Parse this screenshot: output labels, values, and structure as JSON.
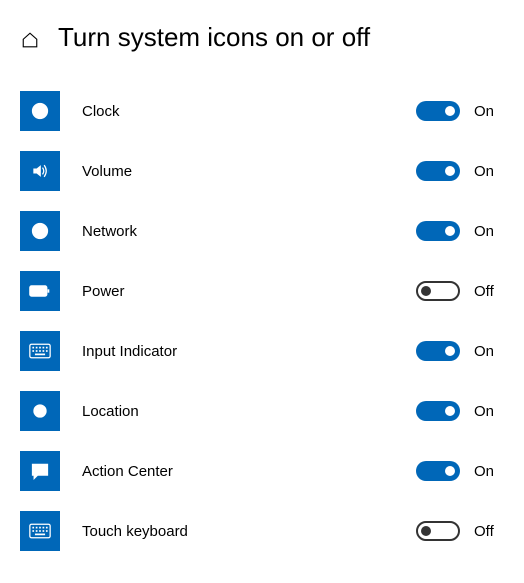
{
  "header": {
    "title": "Turn system icons on or off"
  },
  "state_labels": {
    "on": "On",
    "off": "Off"
  },
  "items": [
    {
      "id": "clock",
      "label": "Clock",
      "on": true
    },
    {
      "id": "volume",
      "label": "Volume",
      "on": true
    },
    {
      "id": "network",
      "label": "Network",
      "on": true
    },
    {
      "id": "power",
      "label": "Power",
      "on": false
    },
    {
      "id": "input-indicator",
      "label": "Input Indicator",
      "on": true
    },
    {
      "id": "location",
      "label": "Location",
      "on": true
    },
    {
      "id": "action-center",
      "label": "Action Center",
      "on": true
    },
    {
      "id": "touch-keyboard",
      "label": "Touch keyboard",
      "on": false
    }
  ]
}
